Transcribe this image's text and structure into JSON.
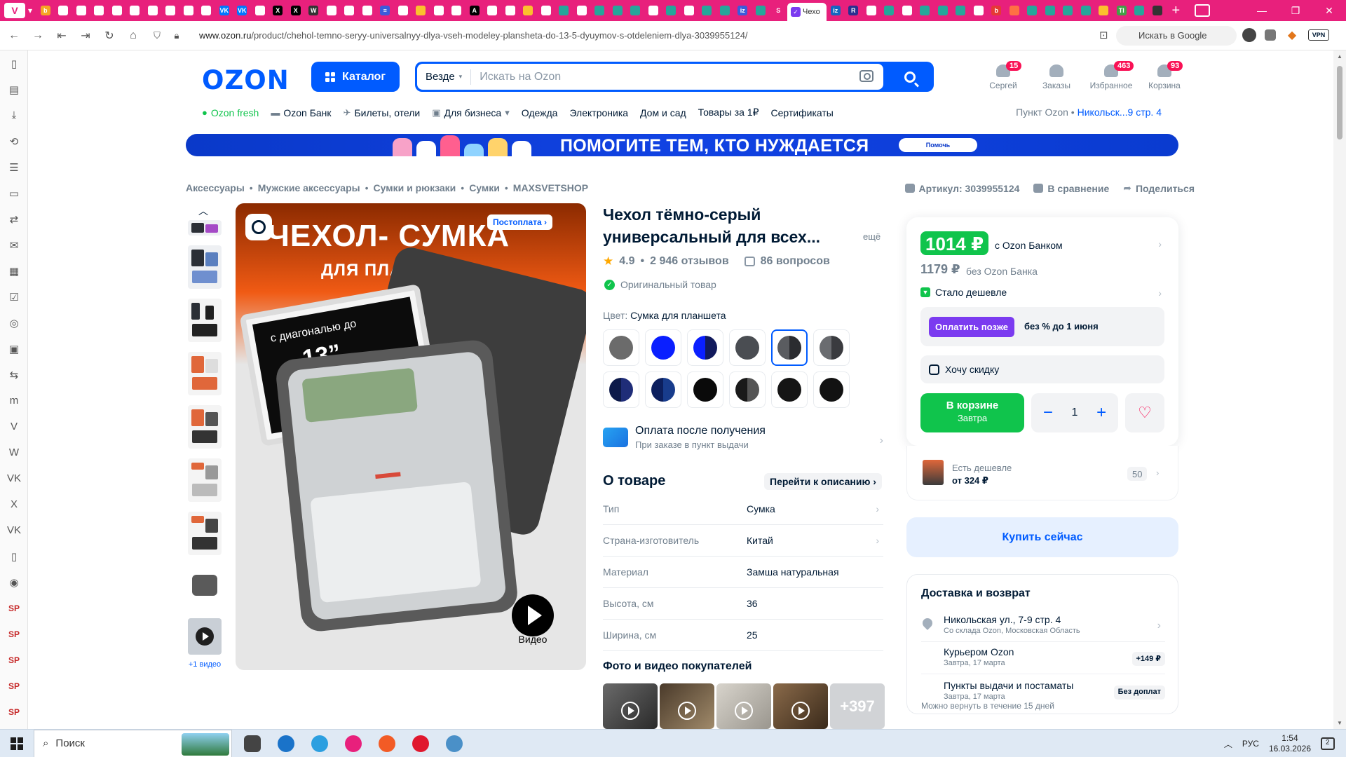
{
  "browser": {
    "active_tab_title": "Чехо",
    "url_host": "www.ozon.ru",
    "url_path": "/product/chehol-temno-seryy-universalnyy-dlya-vseh-modeley-plansheta-do-13-5-dyuymov-s-otdeleniem-dlya-3039955124/",
    "google_search_placeholder": "Искать в Google",
    "vpn_label": "VPN",
    "tab_favicons": [
      {
        "glyph": "b",
        "color": "#f5a623"
      },
      {
        "glyph": "",
        "color": "#fff"
      },
      {
        "glyph": "",
        "color": "#fff"
      },
      {
        "glyph": "",
        "color": "#fff"
      },
      {
        "glyph": "",
        "color": "#fff"
      },
      {
        "glyph": "",
        "color": "#fff"
      },
      {
        "glyph": "",
        "color": "#fff"
      },
      {
        "glyph": "",
        "color": "#fff"
      },
      {
        "glyph": "",
        "color": "#fff"
      },
      {
        "glyph": "",
        "color": "#fff"
      },
      {
        "glyph": "VK",
        "color": "#0077ff"
      },
      {
        "glyph": "VK",
        "color": "#0077ff"
      },
      {
        "glyph": "",
        "color": "#fff"
      },
      {
        "glyph": "X",
        "color": "#000"
      },
      {
        "glyph": "X",
        "color": "#000"
      },
      {
        "glyph": "W",
        "color": "#333"
      },
      {
        "glyph": "",
        "color": "#fff"
      },
      {
        "glyph": "",
        "color": "#fff"
      },
      {
        "glyph": "",
        "color": "#fff"
      },
      {
        "glyph": "≡",
        "color": "#3b5bdb"
      },
      {
        "glyph": "",
        "color": "#fff"
      },
      {
        "glyph": "",
        "color": "#fbc02d"
      },
      {
        "glyph": "",
        "color": "#fff"
      },
      {
        "glyph": "",
        "color": "#fff"
      },
      {
        "glyph": "A",
        "color": "#000"
      },
      {
        "glyph": "",
        "color": "#fff"
      },
      {
        "glyph": "",
        "color": "#fff"
      },
      {
        "glyph": "",
        "color": "#fbc02d"
      },
      {
        "glyph": "",
        "color": "#fff"
      },
      {
        "glyph": "",
        "color": "#26a69a"
      },
      {
        "glyph": "",
        "color": "#fff"
      },
      {
        "glyph": "",
        "color": "#26a69a"
      },
      {
        "glyph": "",
        "color": "#26a69a"
      },
      {
        "glyph": "",
        "color": "#26a69a"
      },
      {
        "glyph": "",
        "color": "#fff"
      },
      {
        "glyph": "",
        "color": "#26a69a"
      },
      {
        "glyph": "",
        "color": "#fff"
      },
      {
        "glyph": "",
        "color": "#26a69a"
      },
      {
        "glyph": "",
        "color": "#26a69a"
      },
      {
        "glyph": "iz",
        "color": "#3b5bdb"
      },
      {
        "glyph": "",
        "color": "#26a69a"
      },
      {
        "glyph": "S",
        "color": "#e8207c"
      }
    ],
    "tab_favicons_after": [
      {
        "glyph": "iz",
        "color": "#1565c0"
      },
      {
        "glyph": "R",
        "color": "#2b2f8f"
      },
      {
        "glyph": "",
        "color": "#fff"
      },
      {
        "glyph": "",
        "color": "#26a69a"
      },
      {
        "glyph": "",
        "color": "#fff"
      },
      {
        "glyph": "",
        "color": "#26a69a"
      },
      {
        "glyph": "",
        "color": "#26a69a"
      },
      {
        "glyph": "",
        "color": "#26a69a"
      },
      {
        "glyph": "",
        "color": "#fff"
      },
      {
        "glyph": "b",
        "color": "#e53935"
      },
      {
        "glyph": "",
        "color": "#ff7043"
      },
      {
        "glyph": "",
        "color": "#26a69a"
      },
      {
        "glyph": "",
        "color": "#26a69a"
      },
      {
        "glyph": "",
        "color": "#26a69a"
      },
      {
        "glyph": "",
        "color": "#26a69a"
      },
      {
        "glyph": "",
        "color": "#fbc02d"
      },
      {
        "glyph": "TI",
        "color": "#43a047"
      },
      {
        "glyph": "",
        "color": "#26a69a"
      },
      {
        "glyph": "",
        "color": "#333"
      }
    ]
  },
  "sidebar": {
    "icons": [
      "bookmark-icon",
      "notes-icon",
      "download-icon",
      "history-icon",
      "reading-list-icon",
      "window-icon",
      "translate-icon",
      "mail-icon",
      "calendar-icon",
      "tasks-icon",
      "feed-icon",
      "contacts-icon",
      "sync-icon",
      "mastodon-icon",
      "vivaldi-icon",
      "wikipedia-icon",
      "vk-icon",
      "x-icon",
      "vk-icon-2",
      "page-icon",
      "web-icon"
    ],
    "icon_glyphs": [
      "▯",
      "▤",
      "⤓",
      "⟲",
      "☰",
      "▭",
      "⇄",
      "✉",
      "▦",
      "☑",
      "◎",
      "▣",
      "⇆",
      "m",
      "V",
      "W",
      "VK",
      "X",
      "VK",
      "▯",
      "◉"
    ],
    "sp_labels": [
      "SP",
      "SP",
      "SP",
      "SP",
      "SP"
    ]
  },
  "header": {
    "logo": "OZON",
    "catalog_label": "Каталог",
    "scope_label": "Везде",
    "search_placeholder": "Искать на Ozon",
    "items": [
      {
        "label": "Сергей",
        "badge": "15"
      },
      {
        "label": "Заказы",
        "badge": ""
      },
      {
        "label": "Избранное",
        "badge": "463"
      },
      {
        "label": "Корзина",
        "badge": "93"
      }
    ]
  },
  "nav": {
    "fresh": "Ozon fresh",
    "bank": "Ozon Банк",
    "tickets": "Билеты, отели",
    "business": "Для бизнеса",
    "clothes": "Одежда",
    "electronics": "Электроника",
    "home": "Дом и сад",
    "one_rub": "Товары за 1₽",
    "certs": "Сертификаты",
    "pickup_label": "Пункт Ozon",
    "pickup_value": "Никольск...9 стр. 4"
  },
  "banner": {
    "text": "ПОМОГИТЕ ТЕМ, КТО НУЖДАЕТСЯ",
    "button": "Помочь"
  },
  "breadcrumbs": [
    "Аксессуары",
    "Мужские аксессуары",
    "Сумки и рюкзаки",
    "Сумки",
    "MAXSVETSHOP"
  ],
  "top_actions": {
    "article": "Артикул: 3039955124",
    "compare": "В сравнение",
    "share": "Поделиться"
  },
  "gallery": {
    "more_video": "+1 видео",
    "image_title_1": "ЧЕХОЛ- СУМКА",
    "image_title_2": "ДЛЯ ПЛАНШЕТА",
    "image_diag": "с диагональю до",
    "image_size": "13”",
    "postpay": "Постоплата",
    "video_label": "Видео"
  },
  "product": {
    "title": "Чехол тёмно-серый универсальный для всех...",
    "more": "ещё",
    "rating": "4.9",
    "reviews": "2 946 отзывов",
    "questions": "86 вопросов",
    "original": "Оригинальный товар",
    "color_label": "Цвет:",
    "color_value": "Сумка для планшета",
    "swatches": [
      {
        "a": "#6b6b6b",
        "b": "#6b6b6b"
      },
      {
        "a": "#0a1fff",
        "b": "#0a1fff"
      },
      {
        "a": "#0a1fff",
        "b": "#111a5c"
      },
      {
        "a": "#4a4d52",
        "b": "#4a4d52"
      },
      {
        "a": "#5a5c60",
        "b": "#2b2c30"
      },
      {
        "a": "#6a6c70",
        "b": "#3a3b3f"
      },
      {
        "a": "#0d1a4a",
        "b": "#1f2d78"
      },
      {
        "a": "#0c1f5e",
        "b": "#183c8c"
      },
      {
        "a": "#0a0a0a",
        "b": "#0a0a0a"
      },
      {
        "a": "#1a1a1a",
        "b": "#555"
      },
      {
        "a": "#151515",
        "b": "#151515"
      },
      {
        "a": "#121212",
        "b": "#121212"
      }
    ],
    "selected_swatch": 4,
    "pay_after_title": "Оплата после получения",
    "pay_after_sub": "При заказе в пункт выдачи",
    "about_title": "О товаре",
    "goto_desc": "Перейти к описанию",
    "specs": [
      {
        "k": "Тип",
        "v": "Сумка",
        "chev": true
      },
      {
        "k": "Страна-изготовитель",
        "v": "Китай",
        "chev": true
      },
      {
        "k": "Материал",
        "v": "Замша натуральная",
        "chev": false
      },
      {
        "k": "Высота, см",
        "v": "36",
        "chev": false
      },
      {
        "k": "Ширина, см",
        "v": "25",
        "chev": false
      }
    ],
    "buyer_media_title": "Фото и видео покупателей",
    "media_more": "+397"
  },
  "price_card": {
    "price": "1014 ₽",
    "price_bank": "с Ozon Банком",
    "old_price": "1179 ₽",
    "old_price_label": "без Ozon Банка",
    "cheaper": "Стало дешевле",
    "later_button": "Оплатить позже",
    "later_text": "без % до 1 июня",
    "discount": "Хочу скидку",
    "cart_label": "В корзине",
    "cart_sub": "Завтра",
    "qty": "1",
    "minus": "−",
    "plus": "+"
  },
  "cheaper_card": {
    "title": "Есть дешевле",
    "price": "от 324 ₽",
    "count": "50"
  },
  "buy_now": "Купить сейчас",
  "delivery": {
    "title": "Доставка и возврат",
    "rows": [
      {
        "t1": "Никольская ул., 7-9 стр. 4",
        "t2": "Со склада Ozon, Московская Область",
        "tag": ""
      },
      {
        "t1": "Курьером Ozon",
        "t2": "Завтра, 17 марта",
        "tag": "+149 ₽"
      },
      {
        "t1": "Пункты выдачи и постаматы",
        "t2": "Завтра, 17 марта",
        "tag": "Без доплат"
      }
    ],
    "cut_text": "Можно вернуть в течение 15 дней"
  },
  "taskbar": {
    "search_label": "Поиск",
    "lang": "РУС",
    "time": "1:54",
    "date": "16.03.2026",
    "notif_count": "2",
    "apps": [
      {
        "name": "task-view-icon",
        "color": "#444"
      },
      {
        "name": "outlook-icon",
        "color": "#1a73c9"
      },
      {
        "name": "edge-icon",
        "color": "#2b9fe0"
      },
      {
        "name": "vivaldi-taskbar-icon",
        "color": "#e8207c"
      },
      {
        "name": "brave-icon",
        "color": "#f25b25"
      },
      {
        "name": "opera-icon",
        "color": "#e0172d"
      },
      {
        "name": "telegram-icon",
        "color": "#4a90c8"
      }
    ]
  }
}
